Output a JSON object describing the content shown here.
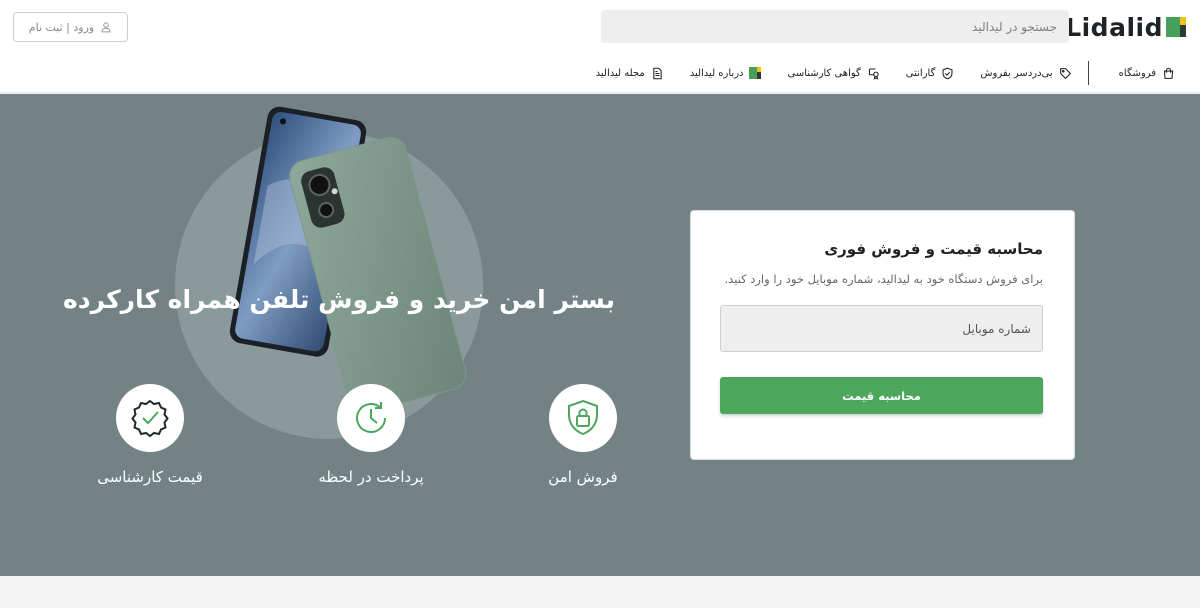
{
  "header": {
    "logo_text": "Lidalid",
    "search_placeholder": "جستجو در لیدالید",
    "login_label": "ورود | ثبت نام"
  },
  "nav": {
    "items": [
      {
        "label": "فروشگاه",
        "icon": "shopping-bag-icon"
      },
      {
        "label": "بی‌دردسر بفروش",
        "icon": "tag-icon"
      },
      {
        "label": "گارانتی",
        "icon": "shield-check-icon"
      },
      {
        "label": "گواهی کارشناسی",
        "icon": "certificate-icon"
      },
      {
        "label": "درباره لیدالید",
        "icon": "lidalid-logo-icon"
      },
      {
        "label": "مجله لیدالید",
        "icon": "document-icon"
      }
    ]
  },
  "hero": {
    "title": "بستر امن خرید و فروش تلفن همراه کارکرده",
    "features": [
      {
        "label": "فروش امن",
        "icon": "shield-lock-icon"
      },
      {
        "label": "پرداخت در لحظه",
        "icon": "clock-icon"
      },
      {
        "label": "قیمت کارشناسی",
        "icon": "badge-check-icon"
      }
    ]
  },
  "card": {
    "title": "محاسبه قیمت و فروش فوری",
    "description": "برای فروش دستگاه خود به لیدالید، شماره موبایل خود را وارد کنید.",
    "phone_placeholder": "شماره موبایل",
    "submit_label": "محاسبه قیمت"
  },
  "colors": {
    "hero_bg": "#738385",
    "accent_green": "#4ca75d",
    "logo_yellow": "#f2c21b",
    "logo_dark": "#2d3a33"
  }
}
